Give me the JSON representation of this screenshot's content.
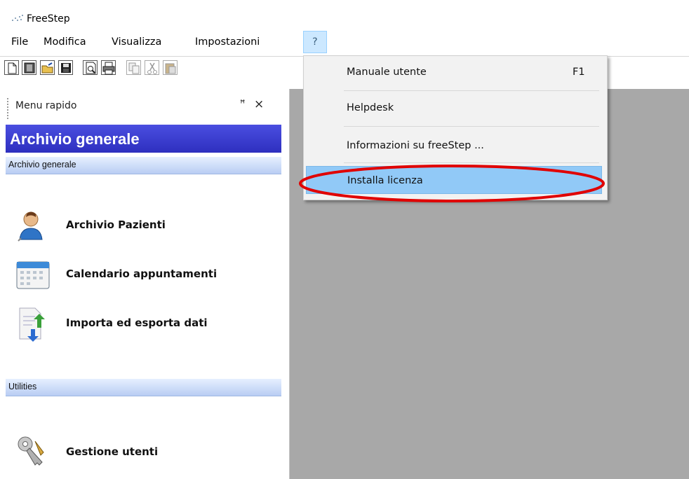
{
  "window": {
    "title": "FreeStep"
  },
  "menubar": {
    "items": [
      "File",
      "Modifica",
      "Visualizza",
      "Impostazioni"
    ],
    "help": "?"
  },
  "toolbar": {
    "buttons": [
      "new-document-icon",
      "properties-icon",
      "open-folder-icon",
      "save-icon",
      "print-preview-icon",
      "print-icon",
      "copy-icon",
      "cut-icon",
      "paste-icon"
    ]
  },
  "sidebar": {
    "panel_title": "Menu rapido",
    "pin": "ꟸ",
    "close": "×",
    "group_title": "Archivio generale",
    "sections": [
      {
        "title": "Archivio generale",
        "items": [
          {
            "label": "Archivio Pazienti",
            "icon": "patient-icon"
          },
          {
            "label": "Calendario appuntamenti",
            "icon": "calendar-icon"
          },
          {
            "label": "Importa ed esporta dati",
            "icon": "import-export-icon"
          }
        ]
      },
      {
        "title": "Utilities",
        "items": [
          {
            "label": "Gestione utenti",
            "icon": "keys-icon"
          }
        ]
      }
    ]
  },
  "help_menu": {
    "items": [
      {
        "label": "Manuale utente",
        "shortcut": "F1"
      },
      {
        "label": "Helpdesk",
        "shortcut": ""
      },
      {
        "label": "Informazioni su freeStep ...",
        "shortcut": ""
      },
      {
        "label": "Installa licenza",
        "shortcut": ""
      }
    ],
    "highlighted_index": 3
  },
  "colors": {
    "header_blue": "#2e2fbf",
    "workspace_gray": "#a8a8a8",
    "menu_highlight": "#91c9f7",
    "annotation_red": "#e00000"
  }
}
